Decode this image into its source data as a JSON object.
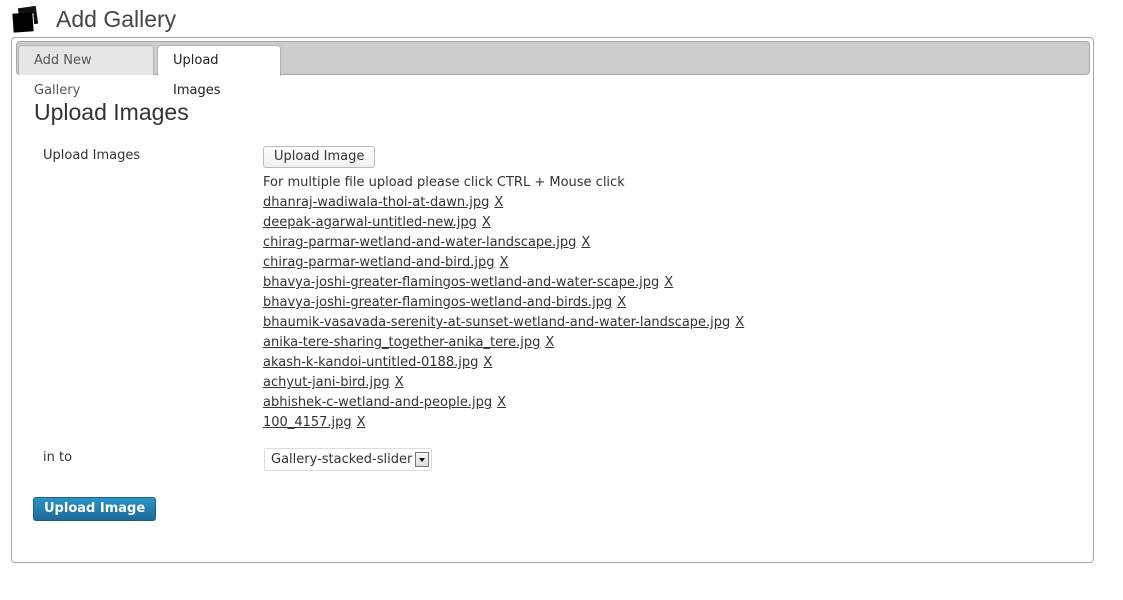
{
  "header": {
    "icon": "gallery-icon",
    "title": "Add Gallery"
  },
  "tabs": [
    {
      "label": "Add New Gallery",
      "active": false
    },
    {
      "label": "Upload Images",
      "active": true
    }
  ],
  "section": {
    "title": "Upload Images",
    "upload_label": "Upload Images",
    "upload_button": "Upload Image",
    "hint": "For multiple file upload please click CTRL + Mouse click",
    "remove_label": "X",
    "files": [
      "dhanraj-wadiwala-thol-at-dawn.jpg",
      "deepak-agarwal-untitled-new.jpg",
      "chirag-parmar-wetland-and-water-landscape.jpg",
      "chirag-parmar-wetland-and-bird.jpg",
      "bhavya-joshi-greater-flamingos-wetland-and-water-scape.jpg",
      "bhavya-joshi-greater-flamingos-wetland-and-birds.jpg",
      "bhaumik-vasavada-serenity-at-sunset-wetland-and-water-landscape.jpg",
      "anika-tere-sharing_together-anika_tere.jpg",
      "akash-k-kandoi-untitled-0188.jpg",
      "achyut-jani-bird.jpg",
      "abhishek-c-wetland-and-people.jpg",
      "100_4157.jpg"
    ],
    "into_label": "in to",
    "gallery_select": "Gallery-stacked-slider",
    "submit_button": "Upload Image"
  },
  "colors": {
    "primary_button": "#2181b5",
    "tabbar_bg": "#cccccc"
  }
}
